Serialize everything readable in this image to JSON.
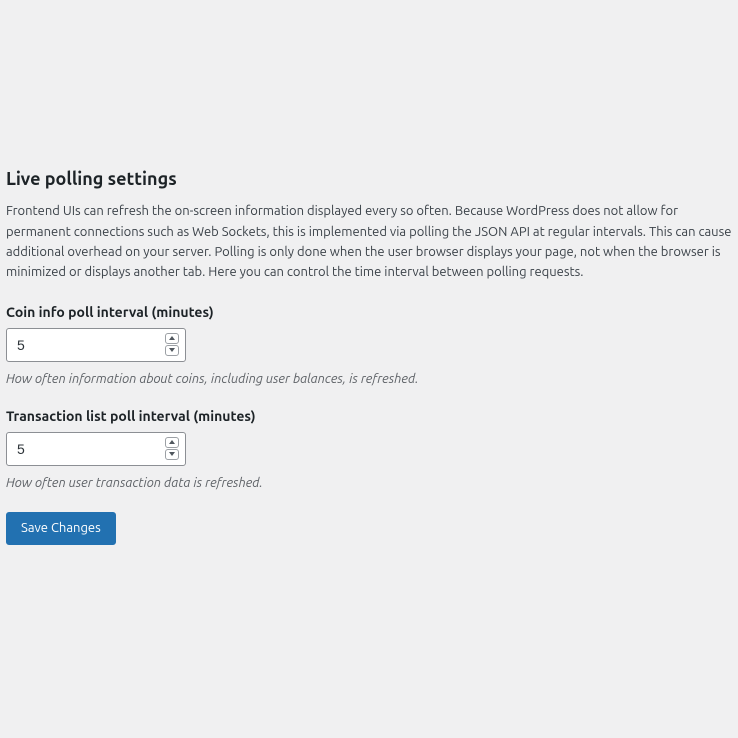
{
  "section": {
    "title": "Live polling settings",
    "description": "Frontend UIs can refresh the on-screen information displayed every so often. Because WordPress does not allow for permanent connections such as Web Sockets, this is implemented via polling the JSON API at regular intervals. This can cause additional overhead on your server. Polling is only done when the user browser displays your page, not when the browser is minimized or displays another tab. Here you can control the time interval between polling requests."
  },
  "fields": {
    "coin_interval": {
      "label": "Coin info poll interval (minutes)",
      "value": "5",
      "description": "How often information about coins, including user balances, is refreshed."
    },
    "tx_interval": {
      "label": "Transaction list poll interval (minutes)",
      "value": "5",
      "description": "How often user transaction data is refreshed."
    }
  },
  "actions": {
    "save_label": "Save Changes"
  }
}
